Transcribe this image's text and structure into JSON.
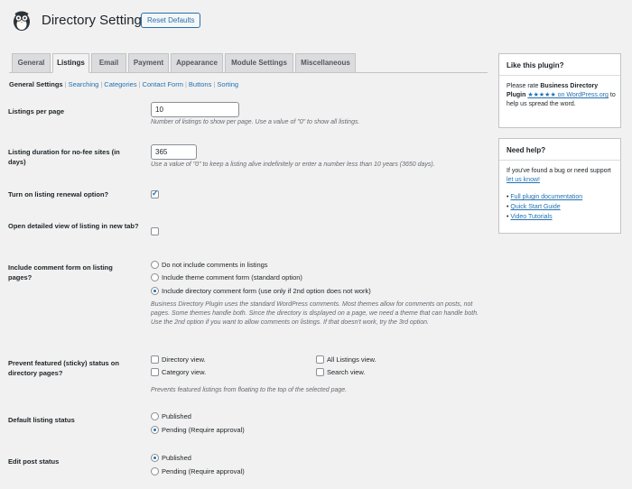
{
  "header": {
    "title": "Directory Settings",
    "reset_label": "Reset Defaults"
  },
  "tabs": [
    {
      "label": "General",
      "active": false
    },
    {
      "label": "Listings",
      "active": true
    },
    {
      "label": "Email",
      "active": false
    },
    {
      "label": "Payment",
      "active": false
    },
    {
      "label": "Appearance",
      "active": false
    },
    {
      "label": "Module Settings",
      "active": false
    },
    {
      "label": "Miscellaneous",
      "active": false
    }
  ],
  "subnav": {
    "current": "General Settings",
    "links": [
      "Searching",
      "Categories",
      "Contact Form",
      "Buttons",
      "Sorting"
    ]
  },
  "settings": {
    "listings_per_page": {
      "label": "Listings per page",
      "value": "10",
      "desc": "Number of listings to show per page. Use a value of \"0\" to show all listings."
    },
    "listing_duration": {
      "label": "Listing duration for no-fee sites (in days)",
      "value": "365",
      "desc": "Use a value of \"0\" to keep a listing alive indefinitely or enter a number less than 10 years (3650 days)."
    },
    "renewal": {
      "label": "Turn on listing renewal option?",
      "checked": true
    },
    "detailed_view": {
      "label": "Open detailed view of listing in new tab?",
      "checked": false
    },
    "comment_form": {
      "label": "Include comment form on listing pages?",
      "options": [
        {
          "label": "Do not include comments in listings",
          "checked": false
        },
        {
          "label": "Include theme comment form (standard option)",
          "checked": false
        },
        {
          "label": "Include directory comment form (use only if 2nd option does not work)",
          "checked": true
        }
      ],
      "desc": "Business Directory Plugin uses the standard WordPress comments. Most themes allow for comments on posts, not pages. Some themes handle both. Since the directory is displayed on a page, we need a theme that can handle both. Use the 2nd option if you want to allow comments on listings. If that doesn't work, try the 3rd option."
    },
    "featured": {
      "label": "Prevent featured (sticky) status on directory pages?",
      "options": [
        {
          "label": "Directory view.",
          "checked": false
        },
        {
          "label": "All Listings view.",
          "checked": false
        },
        {
          "label": "Category view.",
          "checked": false
        },
        {
          "label": "Search view.",
          "checked": false
        }
      ],
      "desc": "Prevents featured listings from floating to the top of the selected page."
    },
    "default_status": {
      "label": "Default listing status",
      "options": [
        {
          "label": "Published",
          "checked": false
        },
        {
          "label": "Pending (Require approval)",
          "checked": true
        }
      ]
    },
    "edit_status": {
      "label": "Edit post status",
      "options": [
        {
          "label": "Published",
          "checked": true
        },
        {
          "label": "Pending (Require approval)",
          "checked": false
        }
      ]
    }
  },
  "sidebar": {
    "rate": {
      "title": "Like this plugin?",
      "text_before": "Please rate ",
      "plugin_name": "Business Directory Plugin",
      "stars_link": "★★★★★ on WordPress.org",
      "text_after": " to help us spread the word."
    },
    "help": {
      "title": "Need help?",
      "text": "If you've found a bug or need support ",
      "link": "let us know!",
      "links": [
        "Full plugin documentation",
        "Quick Start Guide",
        "Video Tutorials"
      ]
    }
  },
  "colors": {
    "accent": "#2271b1",
    "background": "#f1f1f1"
  }
}
